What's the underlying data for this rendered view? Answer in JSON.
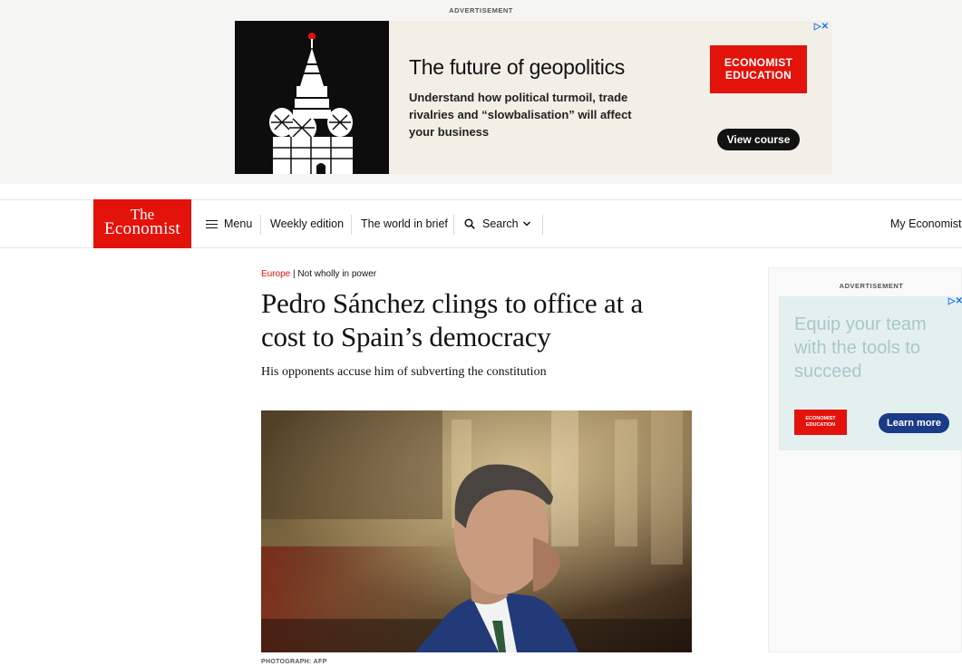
{
  "top_ad": {
    "label": "ADVERTISEMENT",
    "title": "The future of geopolitics",
    "body": "Understand how political turmoil, trade rivalries and “slowbalisation” will affect your business",
    "brand": "ECONOMIST EDUCATION",
    "cta": "View course",
    "adchoices": "▷✕"
  },
  "nav": {
    "logo_line1": "The",
    "logo_line2": "Economist",
    "menu": "Menu",
    "weekly_edition": "Weekly edition",
    "world_in_brief": "The world in brief",
    "search": "Search",
    "my_economist": "My Economist"
  },
  "article": {
    "section": "Europe",
    "kicker_separator": " | ",
    "rubric": "Not wholly in power",
    "headline": "Pedro Sánchez clings to office at a cost to Spain’s democracy",
    "standfirst": "His opponents accuse him of subverting the constitution",
    "photo_credit": "PHOTOGRAPH: AFP"
  },
  "side_ad": {
    "label": "ADVERTISEMENT",
    "title": "Equip your team with the tools to succeed",
    "brand": "ECONOMIST EDUCATION",
    "cta": "Learn more",
    "adchoices": "▷✕"
  },
  "colors": {
    "brand_red": "#e3120b",
    "side_cta_blue": "#1a3b87",
    "side_ad_bg": "#e4f0f0"
  },
  "icons": [
    "menu-icon",
    "search-icon",
    "chevron-down-icon",
    "adchoices-icon"
  ]
}
